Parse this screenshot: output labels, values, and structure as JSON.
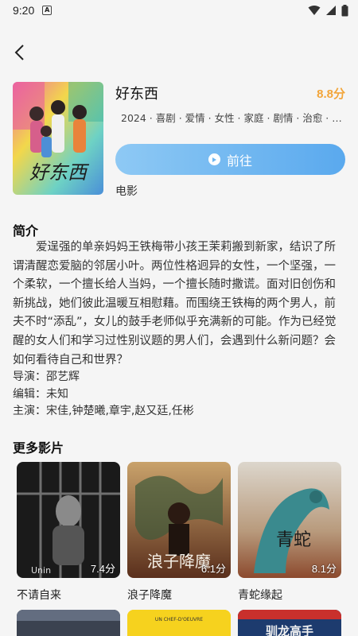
{
  "status_bar": {
    "time": "9:20",
    "sim": "A"
  },
  "detail": {
    "title": "好东西",
    "score": "8.8分",
    "tags": "2024 · 喜剧 · 爱情 · 女性 · 家庭 · 剧情 · 治愈 · 温暖 · …",
    "go_label": "前往",
    "type": "电影",
    "poster_text": "好东西"
  },
  "intro": {
    "heading": "简介",
    "text": "爱逞强的单亲妈妈王铁梅带小孩王茉莉搬到新家，结识了所谓清醒恋爱脑的邻居小叶。两位性格迥异的女性，一个坚强，一个柔软，一个擅长给人当妈，一个擅长随时撒谎。面对旧创伤和新挑战，她们彼此温暖互相慰藉。而围绕王铁梅的两个男人，前夫不时“添乱”，女儿的鼓手老师似乎充满新的可能。作为已经觉醒的女人们和学习过性别议题的男人们，会遇到什么新问题？会如何看待自己和世界？"
  },
  "credits": {
    "director": "导演：邵艺辉",
    "writer": "编辑：未知",
    "cast": "主演：宋佳,钟楚曦,章宇,赵又廷,任彬"
  },
  "more": {
    "heading": "更多影片",
    "movies": [
      {
        "name": "不请自来",
        "score": "7.4分",
        "poster_text": "Unin"
      },
      {
        "name": "浪子降魔",
        "score": "6.1分",
        "poster_text": "浪子降魔"
      },
      {
        "name": "青蛇缘起",
        "score": "8.1分",
        "poster_text": "青蛇"
      }
    ],
    "bottom_posters": [
      {
        "text": ""
      },
      {
        "text": "UN CHEF-D'OEUVRE"
      },
      {
        "text": "驯龙高手"
      }
    ]
  },
  "colors": {
    "accent": "#5aa9ee",
    "score": "#f2a53a",
    "background": "#f5f5f5"
  }
}
